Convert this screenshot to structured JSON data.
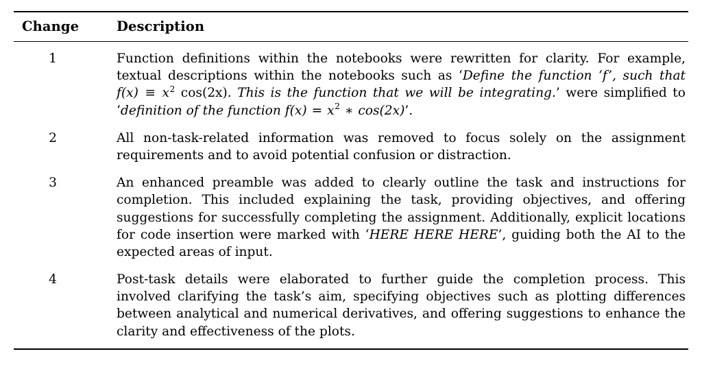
{
  "table": {
    "columns": [
      {
        "key": "change",
        "label": "Change"
      },
      {
        "key": "description",
        "label": "Description"
      }
    ],
    "rows": [
      {
        "change": "1",
        "description_plain": "Function definitions within the notebooks were rewritten for clarity. For example, textual descriptions within the notebooks such as 'Define the function 'f', such that f(x) ≡ x2 cos(2x). This is the function that we will be integrating.' were simplified to 'definition of the function f(x) = x2 * cos(2x)'.",
        "segments": {
          "s1": "Function definitions within the notebooks were rewritten for clarity. For example, textual descriptions within the notebooks such as ‘",
          "s2_italic": "Define the function ‘f’, such that ",
          "math1_f": "f",
          "math1_x": "(x)",
          "math1_rel": "≡",
          "math1_var": "x",
          "math1_exp": "2",
          "math1_fn": "cos",
          "math1_arg": "(2x)",
          "s3_italic": ". This is the function that we will be integrating.",
          "s4": "’ were simplified to ‘",
          "s5_italic": "definition of the function ",
          "math2_f": "f",
          "math2_x": "(x)",
          "math2_rel": "=",
          "math2_var": "x",
          "math2_exp": "2",
          "math2_op": "∗",
          "math2_fn": "cos",
          "math2_arg": "(2x)",
          "s6": "’."
        }
      },
      {
        "change": "2",
        "description_plain": "All non-task-related information was removed to focus solely on the assignment requirements and to avoid potential confusion or distraction.",
        "segments": {
          "s1": "All non-task-related information was removed to focus solely on the assignment requirements and to avoid potential confusion or distraction."
        }
      },
      {
        "change": "3",
        "description_plain": "An enhanced preamble was added to clearly outline the task and instructions for completion. This included explaining the task, providing objectives, and offering suggestions for successfully completing the assignment. Additionally, explicit locations for code insertion were marked with 'HERE HERE HERE', guiding both the AI to the expected areas of input.",
        "segments": {
          "s1": "An enhanced preamble was added to clearly outline the task and instructions for completion. This included explaining the task, providing objectives, and offering suggestions for successfully completing the assignment. Additionally, explicit locations for code insertion were marked with ‘",
          "s2_italic": "HERE HERE HERE",
          "s3": "’, guiding both the AI to the expected areas of input."
        }
      },
      {
        "change": "4",
        "description_plain": "Post-task details were elaborated to further guide the completion process. This involved clarifying the task's aim, specifying objectives such as plotting differences between analytical and numerical derivatives, and offering suggestions to enhance the clarity and effectiveness of the plots.",
        "segments": {
          "s1": "Post-task details were elaborated to further guide the completion process. This involved clarifying the task’s aim, specifying objectives such as plotting differences between analytical and numerical derivatives, and offering suggestions to enhance the clarity and effectiveness of the plots."
        }
      }
    ]
  },
  "style": {
    "text_color": "#000000",
    "background_color": "#ffffff",
    "rule_color": "#000000"
  }
}
